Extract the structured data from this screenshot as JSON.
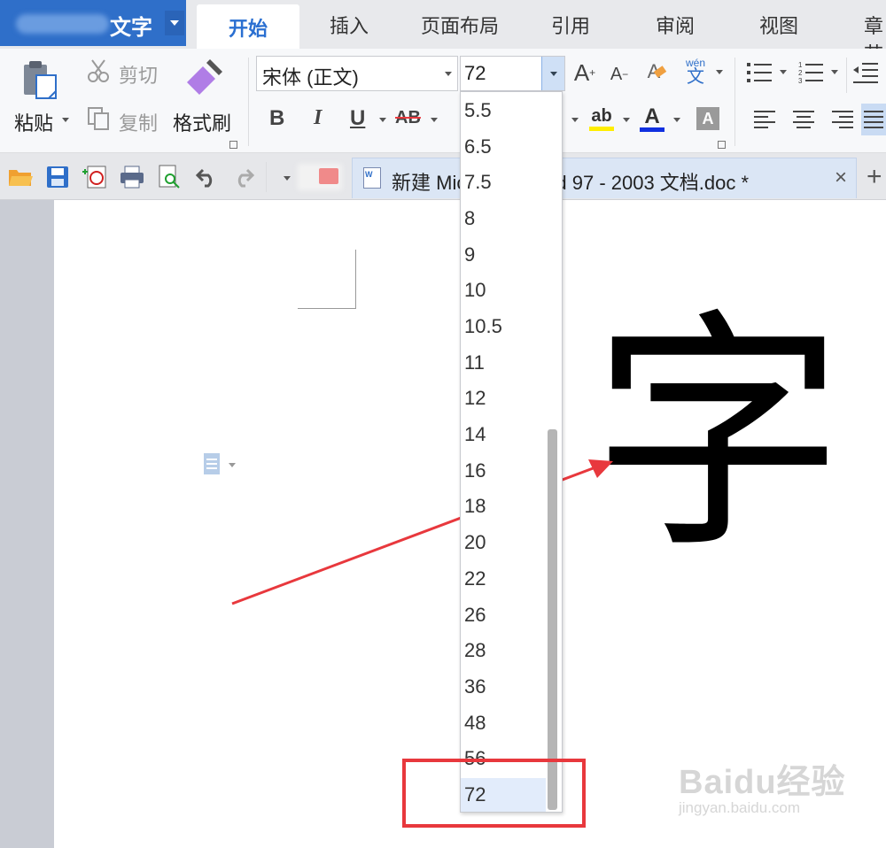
{
  "app": {
    "title": "文字"
  },
  "tabs": [
    "开始",
    "插入",
    "页面布局",
    "引用",
    "审阅",
    "视图",
    "章节"
  ],
  "ribbon": {
    "paste": "粘贴",
    "cut": "剪切",
    "copy": "复制",
    "format_painter": "格式刷",
    "font_name": "宋体 (正文)",
    "font_size": "72",
    "bold": "B",
    "italic": "I",
    "underline": "U",
    "strikethrough": "AB",
    "font_color": "A",
    "char_shading": "A",
    "phonetic": "wén",
    "phonetic_char": "文"
  },
  "document_tab": {
    "title": "新建 Microsoft Word 97 - 2003 文档.doc *",
    "close": "×",
    "new_tab": "+"
  },
  "font_size_dropdown": {
    "options": [
      "5.5",
      "6.5",
      "7.5",
      "8",
      "9",
      "10",
      "10.5",
      "11",
      "12",
      "14",
      "16",
      "18",
      "20",
      "22",
      "26",
      "28",
      "36",
      "48",
      "56",
      "72"
    ],
    "selected": "72"
  },
  "document": {
    "content": "字"
  },
  "watermark": {
    "line1": "Baidu经验",
    "line2": "jingyan.baidu.com"
  },
  "colors": {
    "accent": "#2f6fc9",
    "highlight_box": "#e8383d",
    "arrow": "#e8383d",
    "selected_option": "#e2ecfb"
  }
}
